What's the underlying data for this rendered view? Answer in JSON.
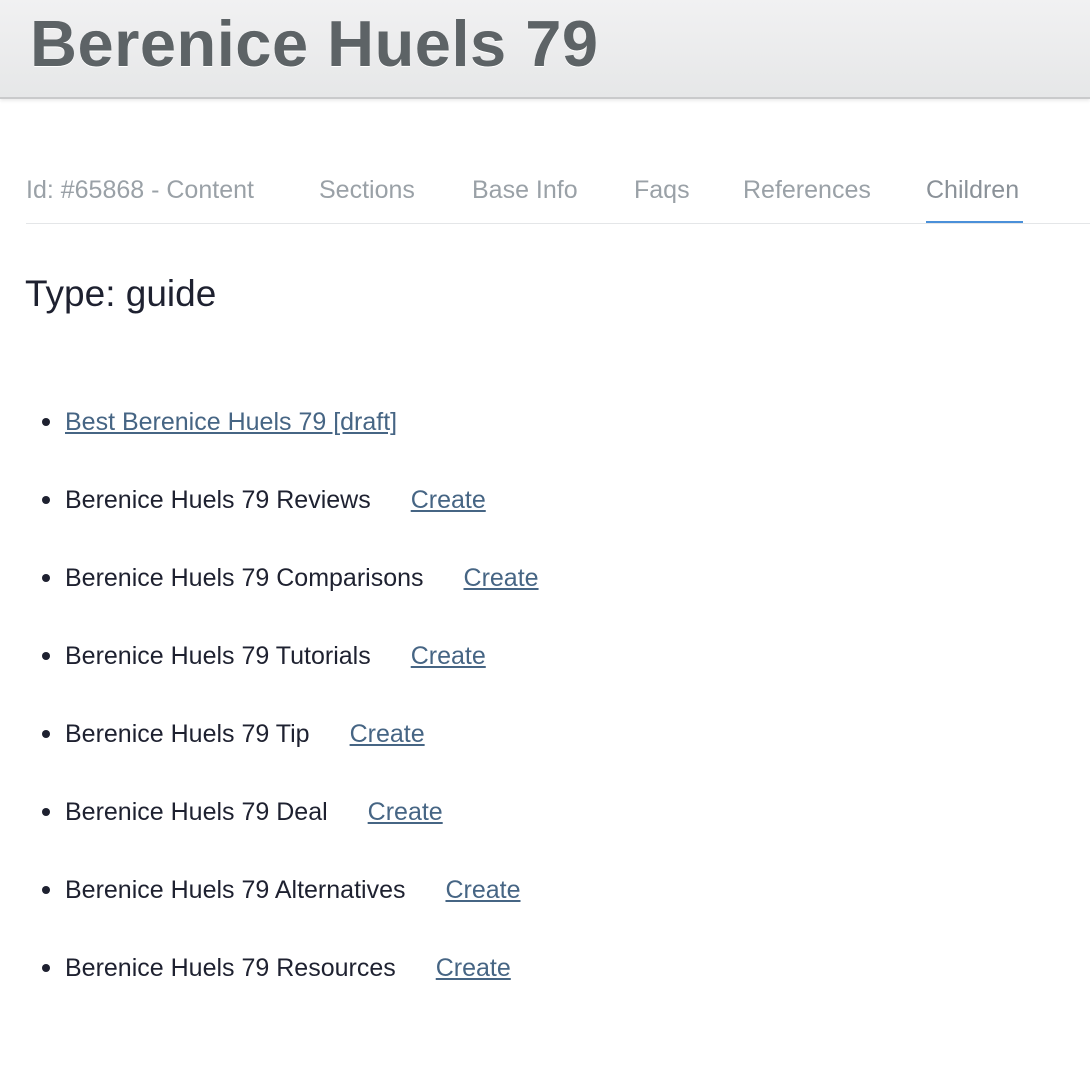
{
  "header": {
    "title": "Berenice Huels 79"
  },
  "tabs": [
    {
      "label": "Id: #65868 - Content",
      "active": false
    },
    {
      "label": "Sections",
      "active": false
    },
    {
      "label": "Base Info",
      "active": false
    },
    {
      "label": "Faqs",
      "active": false
    },
    {
      "label": "References",
      "active": false
    },
    {
      "label": "Children",
      "active": true
    }
  ],
  "main": {
    "type_heading": "Type: guide",
    "children": [
      {
        "label": "Best Berenice Huels 79 [draft]",
        "is_link": true,
        "create_label": ""
      },
      {
        "label": "Berenice Huels 79 Reviews",
        "is_link": false,
        "create_label": "Create"
      },
      {
        "label": "Berenice Huels 79 Comparisons",
        "is_link": false,
        "create_label": "Create"
      },
      {
        "label": "Berenice Huels 79 Tutorials",
        "is_link": false,
        "create_label": "Create"
      },
      {
        "label": "Berenice Huels 79 Tip",
        "is_link": false,
        "create_label": "Create"
      },
      {
        "label": "Berenice Huels 79 Deal",
        "is_link": false,
        "create_label": "Create"
      },
      {
        "label": "Berenice Huels 79 Alternatives",
        "is_link": false,
        "create_label": "Create"
      },
      {
        "label": "Berenice Huels 79 Resources",
        "is_link": false,
        "create_label": "Create"
      }
    ]
  },
  "colors": {
    "link": "#466584",
    "tab_text": "#9aa1a7",
    "tab_active_underline": "#4a90d9",
    "heading_text": "#1e2130",
    "title_text": "#5d6366"
  }
}
